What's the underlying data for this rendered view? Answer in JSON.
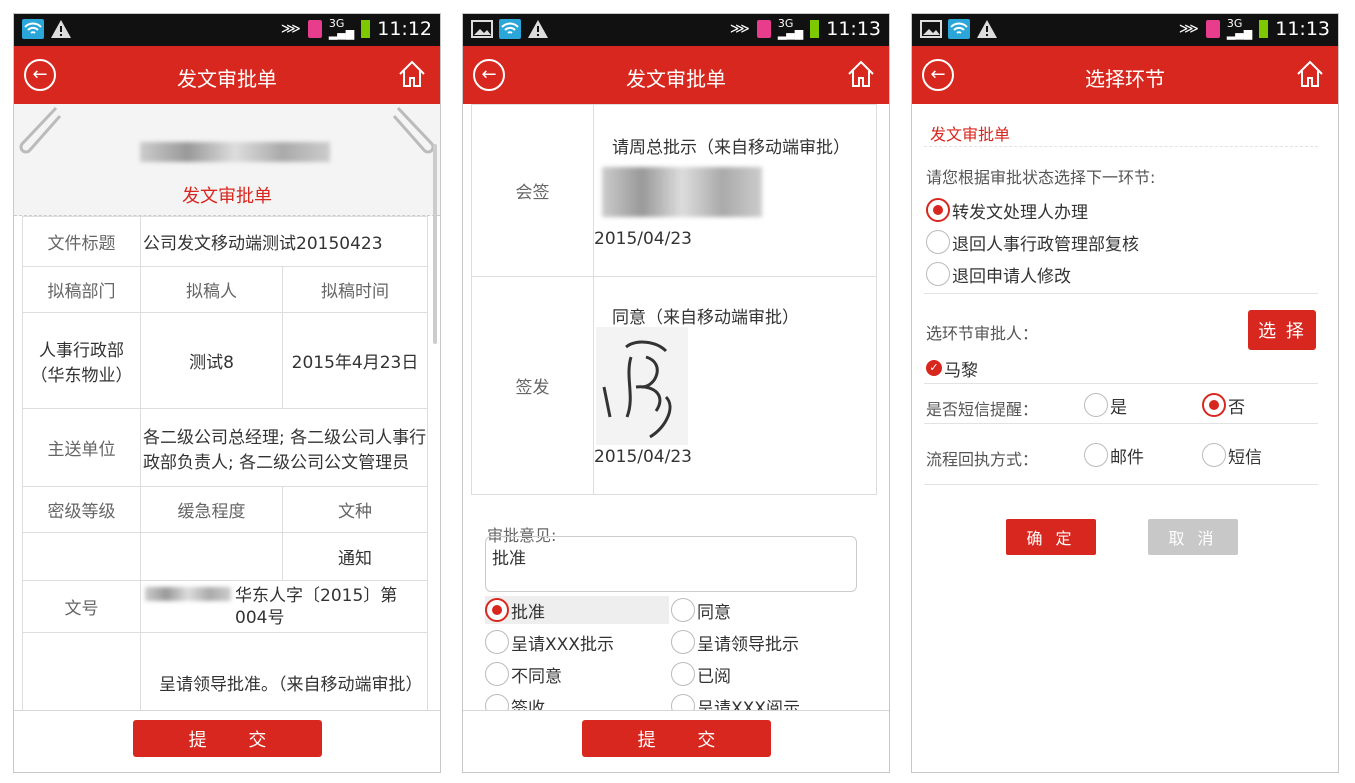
{
  "status_bars": [
    {
      "time": "11:12"
    },
    {
      "time": "11:13"
    },
    {
      "time": "11:13"
    }
  ],
  "screen1": {
    "title": "发文审批单",
    "doc_title": "发文审批单",
    "fields": {
      "file_title_label": "文件标题",
      "file_title_value": "公司发文移动端测试20150423",
      "dept_label": "拟稿部门",
      "drafter_label": "拟稿人",
      "time_label": "拟稿时间",
      "dept_value": "人事行政部（华东物业）",
      "drafter_value": "测试8",
      "time_value": "2015年4月23日",
      "send_label": "主送单位",
      "send_value": "各二级公司总经理; 各二级公司人事行政部负责人; 各二级公司公文管理员",
      "secret_label": "密级等级",
      "urgency_label": "缓急程度",
      "type_label": "文种",
      "type_value": "通知",
      "docno_label": "文号",
      "docno_value": "华东人字〔2015〕第004号",
      "opinion_value": "呈请领导批准。（来自移动端审批）"
    },
    "submit": "提 交"
  },
  "screen2": {
    "title": "发文审批单",
    "countersign_label": "会签",
    "countersign_text": "请周总批示（来自移动端审批）",
    "countersign_date": "2015/04/23",
    "issue_label": "签发",
    "issue_text": "同意（来自移动端审批）",
    "issue_date": "2015/04/23",
    "opinion_label": "审批意见:",
    "opinion_value": "批准",
    "options": [
      "批准",
      "同意",
      "呈请XXX批示",
      "呈请领导批示",
      "不同意",
      "已阅",
      "签收",
      "呈请XXX阅示"
    ],
    "selected_option": "批准",
    "submit": "提 交"
  },
  "screen3": {
    "title": "选择环节",
    "section": "发文审批单",
    "prompt": "请您根据审批状态选择下一环节:",
    "next_steps": [
      "转发文处理人办理",
      "退回人事行政管理部复核",
      "退回申请人修改"
    ],
    "selected_step": "转发文处理人办理",
    "approver_label": "选环节审批人：",
    "select_button": "选 择",
    "approver": "马黎",
    "sms_label": "是否短信提醒：",
    "sms_yes": "是",
    "sms_no": "否",
    "sms_selected": "否",
    "receipt_label": "流程回执方式：",
    "receipt_mail": "邮件",
    "receipt_sms": "短信",
    "confirm": "确 定",
    "cancel": "取 消"
  },
  "colors": {
    "accent": "#d8271e",
    "cancel_gray": "#c8c8c8"
  }
}
